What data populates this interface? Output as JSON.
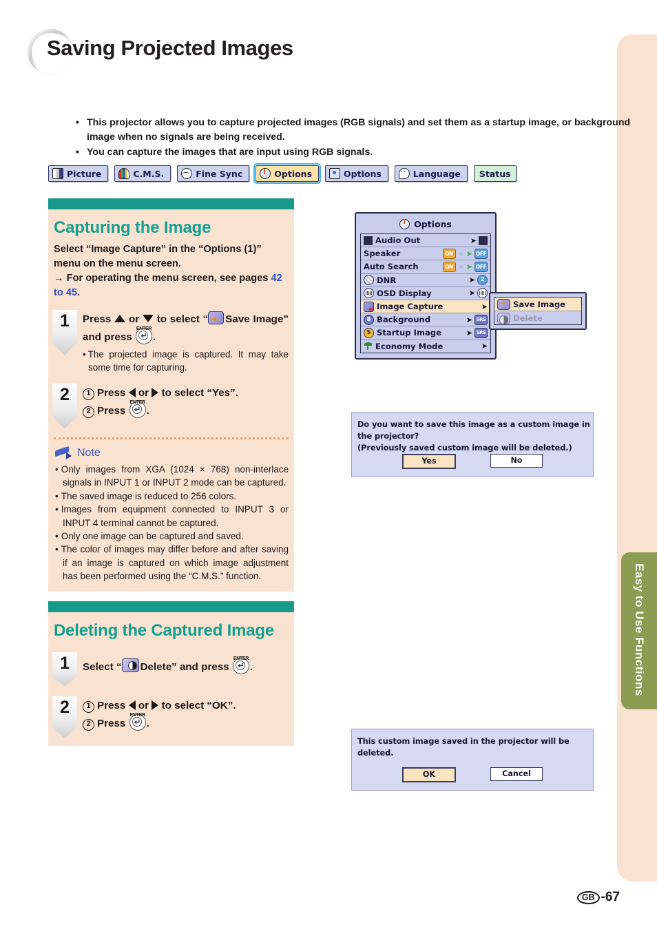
{
  "page": {
    "title": "Saving Projected Images",
    "footer_region": "GB",
    "footer_page": "-67",
    "side_tab": "Easy to Use Functions",
    "accent_teal": "#17998c",
    "accent_peach": "#fae2d0",
    "accent_olive": "#8c9c52",
    "link_blue": "#2d4fd0"
  },
  "intro": {
    "bullets": [
      "This projector allows you to capture projected images (RGB signals) and set them as a startup image, or background image when no signals are being received.",
      "You can capture the images that are input using RGB signals."
    ]
  },
  "tabbar": {
    "tabs": [
      {
        "label": "Picture",
        "icon": "picture-icon",
        "selected": false
      },
      {
        "label": "C.M.S.",
        "icon": "cms-icon",
        "selected": false
      },
      {
        "label": "Fine Sync",
        "icon": "fine-sync-icon",
        "selected": false
      },
      {
        "label": "Options",
        "icon": "options1-icon",
        "selected": true
      },
      {
        "label": "Options",
        "icon": "options2-icon",
        "selected": false
      },
      {
        "label": "Language",
        "icon": "language-icon",
        "selected": false
      },
      {
        "label": "Status",
        "icon": "status-icon",
        "selected": false
      }
    ]
  },
  "capturing": {
    "heading": "Capturing the Image",
    "lead_1": "Select “Image Capture” in the “Options (1)” menu on the menu screen.",
    "lead_2_prefix": "→ For operating the menu screen, see pages ",
    "lead_2_link": "42 to 45",
    "lead_2_suffix": ".",
    "step1": {
      "number": "1",
      "text_a": "Press",
      "text_b": "or",
      "text_c": "to select “",
      "text_d": "Save Image” and press",
      "text_e": ".",
      "enter_label": "ENTER",
      "sub": "The projected image is captured. It may take some time for capturing."
    },
    "step2": {
      "number": "2",
      "line1_num": "1",
      "line1_a": "Press",
      "line1_b": "or",
      "line1_c": "to select “Yes”.",
      "line2_num": "2",
      "line2_a": "Press",
      "line2_b": ".",
      "enter_label": "ENTER"
    }
  },
  "note": {
    "title": "Note",
    "items": [
      "Only images from XGA (1024 × 768) non-interlace signals in INPUT 1 or INPUT 2 mode can be captured.",
      "The saved image is reduced to 256 colors.",
      "Images from equipment connected to INPUT 3 or INPUT 4 terminal cannot be captured.",
      "Only one image can be captured and saved.",
      "The color of images may differ before and after saving if an image is captured on which image adjustment has been performed using the “C.M.S.” function."
    ]
  },
  "deleting": {
    "heading": "Deleting the Captured Image",
    "step1": {
      "number": "1",
      "text_a": "Select “",
      "text_b": "Delete” and press",
      "text_c": ".",
      "enter_label": "ENTER"
    },
    "step2": {
      "number": "2",
      "line1_num": "1",
      "line1_a": "Press",
      "line1_b": "or",
      "line1_c": "to select “OK”.",
      "line2_num": "2",
      "line2_a": "Press",
      "line2_b": ".",
      "enter_label": "ENTER"
    }
  },
  "osd_menu": {
    "title": "Options",
    "rows": [
      {
        "label": "Audio Out",
        "icon": "audio-out-icon",
        "right": "arrow-speaker",
        "highlight": false
      },
      {
        "label": "Speaker",
        "icon": "none",
        "right": "on-off",
        "highlight": false
      },
      {
        "label": "Auto Search",
        "icon": "none",
        "right": "on-off",
        "highlight": false
      },
      {
        "label": "DNR",
        "icon": "dnr-icon",
        "right": "arrow-num-2",
        "highlight": false
      },
      {
        "label": "OSD Display",
        "icon": "osd-display-icon",
        "right": "arrow-osd",
        "highlight": false
      },
      {
        "label": "Image Capture",
        "icon": "image-capture-icon",
        "right": "arrow",
        "highlight": true
      },
      {
        "label": "Background",
        "icon": "background-icon",
        "right": "arrow-srs",
        "highlight": false
      },
      {
        "label": "Startup Image",
        "icon": "startup-image-icon",
        "right": "arrow-srs",
        "highlight": false
      },
      {
        "label": "Economy Mode",
        "icon": "economy-mode-icon",
        "right": "arrow",
        "highlight": false
      }
    ],
    "on_label": "ON",
    "off_label": "OFF",
    "dnr_value": "2",
    "background_value": "SRS",
    "startup_value": "SRS"
  },
  "osd_submenu": {
    "items": [
      {
        "label": "Save Image",
        "icon": "save-image-icon",
        "highlight": true,
        "disabled": false
      },
      {
        "label": "Delete",
        "icon": "delete-icon",
        "highlight": false,
        "disabled": true
      }
    ]
  },
  "dialog_save": {
    "line1": "Do you want to save this image as a custom image in the projector?",
    "line2": "(Previously saved custom image will be deleted.)",
    "yes": "Yes",
    "no": "No"
  },
  "dialog_delete": {
    "line1": "This custom image saved in the projector will be deleted.",
    "ok": "OK",
    "cancel": "Cancel"
  }
}
